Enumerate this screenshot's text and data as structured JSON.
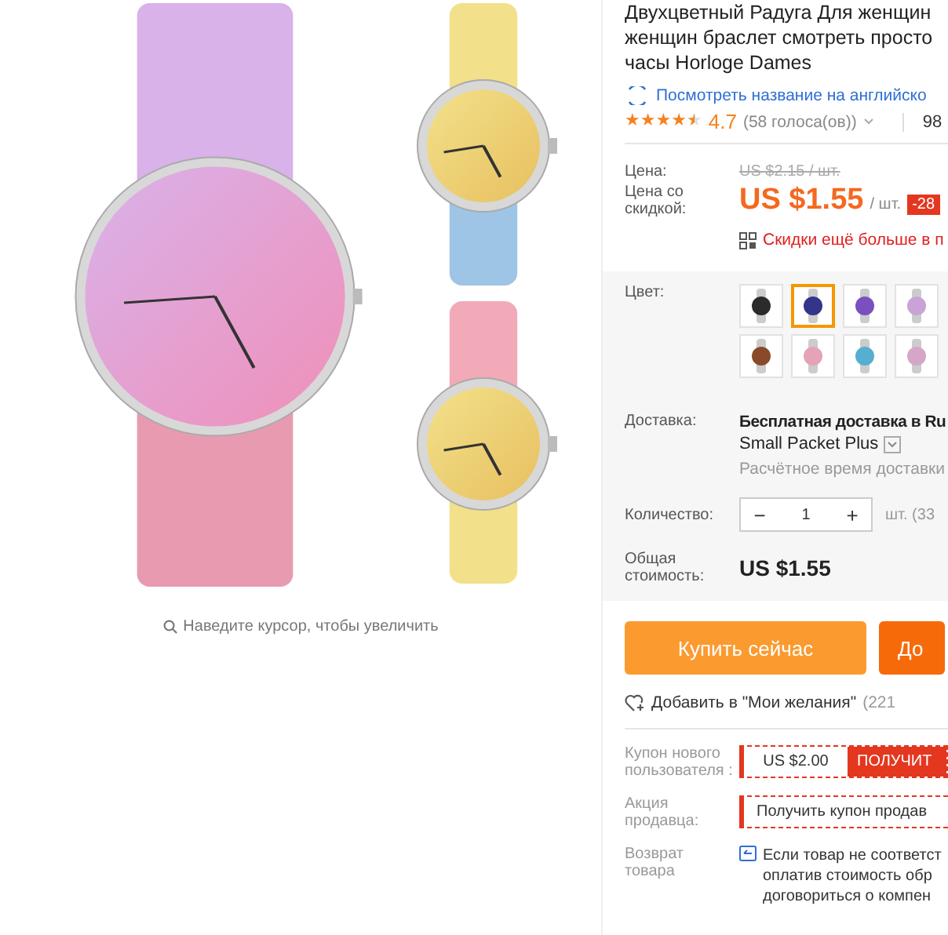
{
  "gallery": {
    "zoom_hint": "Наведите курсор, чтобы увеличить"
  },
  "product": {
    "title_lines": [
      "Двухцветный Радуга Для женщин",
      "женщин браслет смотреть просто",
      "часы Horloge Dames"
    ],
    "translate_link": "Посмотреть название на английско",
    "stars": 4.5,
    "rating": "4.7",
    "votes": "(58 голоса(ов))",
    "orders": "98"
  },
  "price": {
    "label": "Цена:",
    "old": "US $2.15 / шт.",
    "discount_label": "Цена со скидкой:",
    "value": "US $1.55",
    "unit": "/ шт.",
    "badge": "-28",
    "promo": "Скидки ещё больше в п"
  },
  "color": {
    "label": "Цвет:",
    "swatches": [
      {
        "color": "#2b2b2b",
        "selected": false
      },
      {
        "color": "#33358a",
        "selected": true
      },
      {
        "color": "#7a4fc0",
        "selected": false
      },
      {
        "color": "#c9a3d6",
        "selected": false
      },
      {
        "color": "#8a4a2a",
        "selected": false
      },
      {
        "color": "#e6a2b6",
        "selected": false
      },
      {
        "color": "#56aed0",
        "selected": false
      },
      {
        "color": "#d6a6c8",
        "selected": false
      }
    ]
  },
  "delivery": {
    "label": "Доставка:",
    "value": "Бесплатная доставка в Ru",
    "method": "Small Packet Plus",
    "estimate": "Расчётное время доставки"
  },
  "quantity": {
    "label": "Количество:",
    "minus": "−",
    "value": "1",
    "plus": "+",
    "note": "шт. (33"
  },
  "total": {
    "label": "Общая стоимость:",
    "value": "US $1.55"
  },
  "buttons": [
    {
      "kind": "buy",
      "label": "Купить сейчас"
    },
    {
      "kind": "cart",
      "label": "До"
    }
  ],
  "wishlist": {
    "label": "Добавить в \"Мои желания\"",
    "count": "(221"
  },
  "coupons": [
    {
      "kind": "new-user",
      "label": "Купон нового пользователя :",
      "amount": "US $2.00",
      "action": "ПОЛУЧИТ"
    },
    {
      "kind": "seller",
      "label": "Акция продавца:",
      "action": "Получить купон продав"
    }
  ],
  "returns": {
    "label": "Возврат товара",
    "lines": [
      "Если товар не соответст",
      "оплатив стоимость обр",
      "договориться о компен"
    ]
  }
}
